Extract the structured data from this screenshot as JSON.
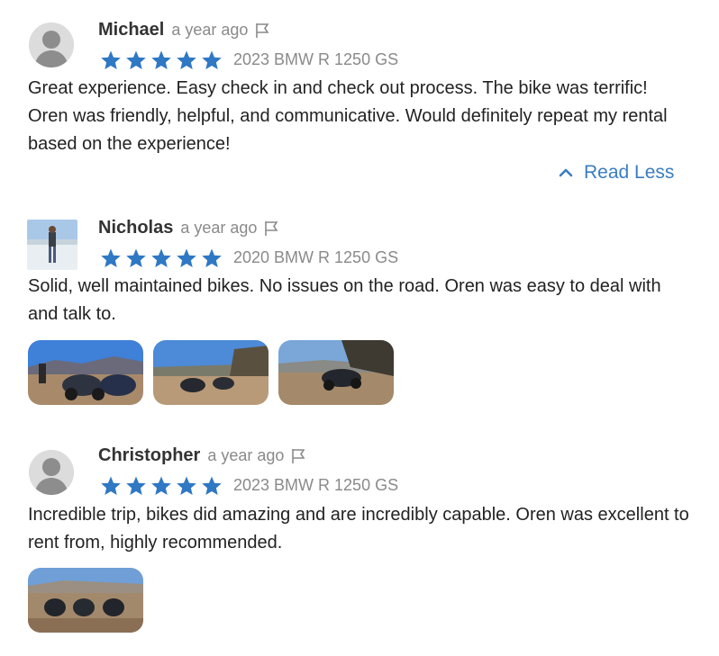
{
  "reviews": [
    {
      "name": "Michael",
      "time": "a year ago",
      "vehicle": "2023 BMW R 1250 GS",
      "rating": 5,
      "text": "Great experience. Easy check in and check out process. The bike was terrific! Oren was friendly, helpful, and communicative. Would definitely repeat my rental based on the experience!",
      "toggle_label": "Read Less"
    },
    {
      "name": "Nicholas",
      "time": "a year ago",
      "vehicle": "2020 BMW R 1250 GS",
      "rating": 5,
      "text": "Solid, well maintained bikes. No issues on the road. Oren was easy to deal with and talk to."
    },
    {
      "name": "Christopher",
      "time": "a year ago",
      "vehicle": "2023 BMW R 1250 GS",
      "rating": 5,
      "text": "Incredible trip, bikes did amazing and are incredibly capable. Oren was excellent to rent from, highly recommended."
    }
  ],
  "colors": {
    "star": "#2f78c4",
    "link": "#3a7dc0",
    "muted": "#8a8a8a"
  },
  "icons": [
    "user-avatar-icon",
    "flag-icon",
    "star-icon",
    "chevron-up-icon"
  ]
}
